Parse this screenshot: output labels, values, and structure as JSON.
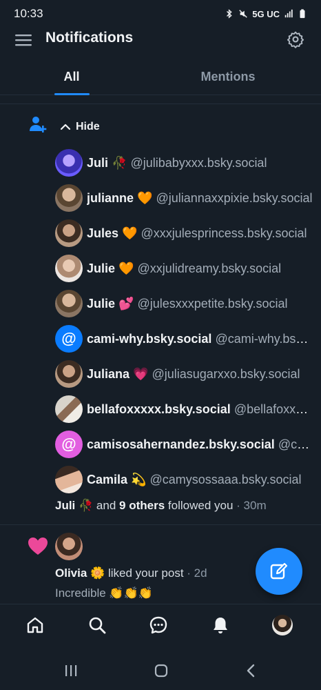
{
  "status_bar": {
    "time": "10:33",
    "network": "5G UC"
  },
  "header": {
    "title": "Notifications"
  },
  "tabs": [
    {
      "label": "All"
    },
    {
      "label": "Mentions"
    }
  ],
  "follow_group": {
    "hide_label": "Hide",
    "followers": [
      {
        "name": "Juli 🥀",
        "handle": "@julibabyxxx.bsky.social"
      },
      {
        "name": "julianne 🧡",
        "handle": "@juliannaxxpixie.bsky.social"
      },
      {
        "name": "Jules 🧡",
        "handle": "@xxxjulesprincess.bsky.social"
      },
      {
        "name": "Julie 🧡",
        "handle": "@xxjulidreamy.bsky.social"
      },
      {
        "name": "Julie 💕",
        "handle": "@julesxxxpetite.bsky.social"
      },
      {
        "name": "cami-why.bsky.social",
        "handle": "@cami-why.bsky.social"
      },
      {
        "name": "Juliana 💗",
        "handle": "@juliasugarxxo.bsky.social"
      },
      {
        "name": "bellafoxxxxx.bsky.social",
        "handle": "@bellafoxxxxx.bsky.social"
      },
      {
        "name": "camisosahernandez.bsky.social",
        "handle": "@camisosahernandez.bsky.social"
      },
      {
        "name": "Camila 💫",
        "handle": "@camysossaaa.bsky.social"
      }
    ],
    "summary": {
      "first": "Juli 🥀",
      "and": "and",
      "others": "9 others",
      "action": "followed you",
      "time": "· 30m"
    }
  },
  "like_notification": {
    "name": "Olivia 🌼",
    "action": "liked your post",
    "time": "· 2d",
    "post_text": "Incredible 👏👏👏"
  },
  "colors": {
    "background": "#161e27",
    "accent": "#208bfe",
    "like": "#ec4899"
  }
}
